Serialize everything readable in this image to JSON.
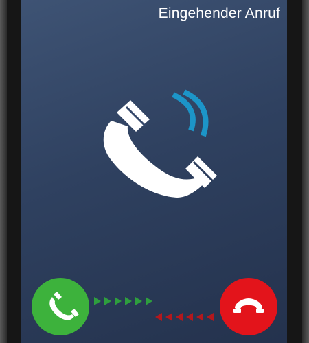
{
  "call": {
    "title": "Eingehender Anruf"
  },
  "icons": {
    "incoming": "ringing-phone-icon",
    "accept": "phone-accept-icon",
    "decline": "phone-hangup-icon",
    "accept_arrows": "swipe-right-arrows",
    "decline_arrows": "swipe-left-arrows"
  },
  "colors": {
    "screen_top": "#3e5374",
    "screen_bottom": "#24324d",
    "ring_waves": "#1c95c8",
    "accept": "#3db23c",
    "decline": "#e3141b",
    "accept_arrows": "#2e9e3e",
    "decline_arrows": "#b3181d"
  }
}
